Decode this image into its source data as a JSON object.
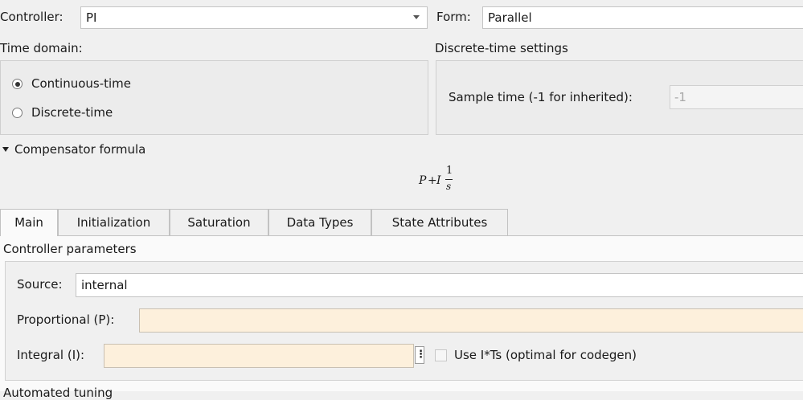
{
  "controller": {
    "label": "Controller:",
    "value": "PI"
  },
  "form": {
    "label": "Form:",
    "value": "Parallel"
  },
  "time_domain": {
    "label": "Time domain:",
    "options": [
      {
        "label": "Continuous-time",
        "selected": true
      },
      {
        "label": "Discrete-time",
        "selected": false
      }
    ]
  },
  "discrete_settings": {
    "title": "Discrete-time settings",
    "sample_time_label": "Sample time (-1 for inherited):",
    "sample_time_value": "-1"
  },
  "compensator": {
    "toggle_label": "Compensator formula",
    "formula": {
      "p": "P",
      "plus": "+",
      "i": "I",
      "num": "1",
      "den": "s"
    }
  },
  "tabs": [
    {
      "label": "Main",
      "active": true
    },
    {
      "label": "Initialization",
      "active": false
    },
    {
      "label": "Saturation",
      "active": false
    },
    {
      "label": "Data Types",
      "active": false
    },
    {
      "label": "State Attributes",
      "active": false
    }
  ],
  "params": {
    "title": "Controller parameters",
    "source_label": "Source:",
    "source_value": "internal",
    "proportional_label": "Proportional (P):",
    "proportional_value": "",
    "integral_label": "Integral (I):",
    "integral_value": "",
    "menu_glyph": "⋮",
    "use_its_label": "Use I*Ts (optimal for codegen)"
  },
  "auto_tuning_label": "Automated tuning"
}
